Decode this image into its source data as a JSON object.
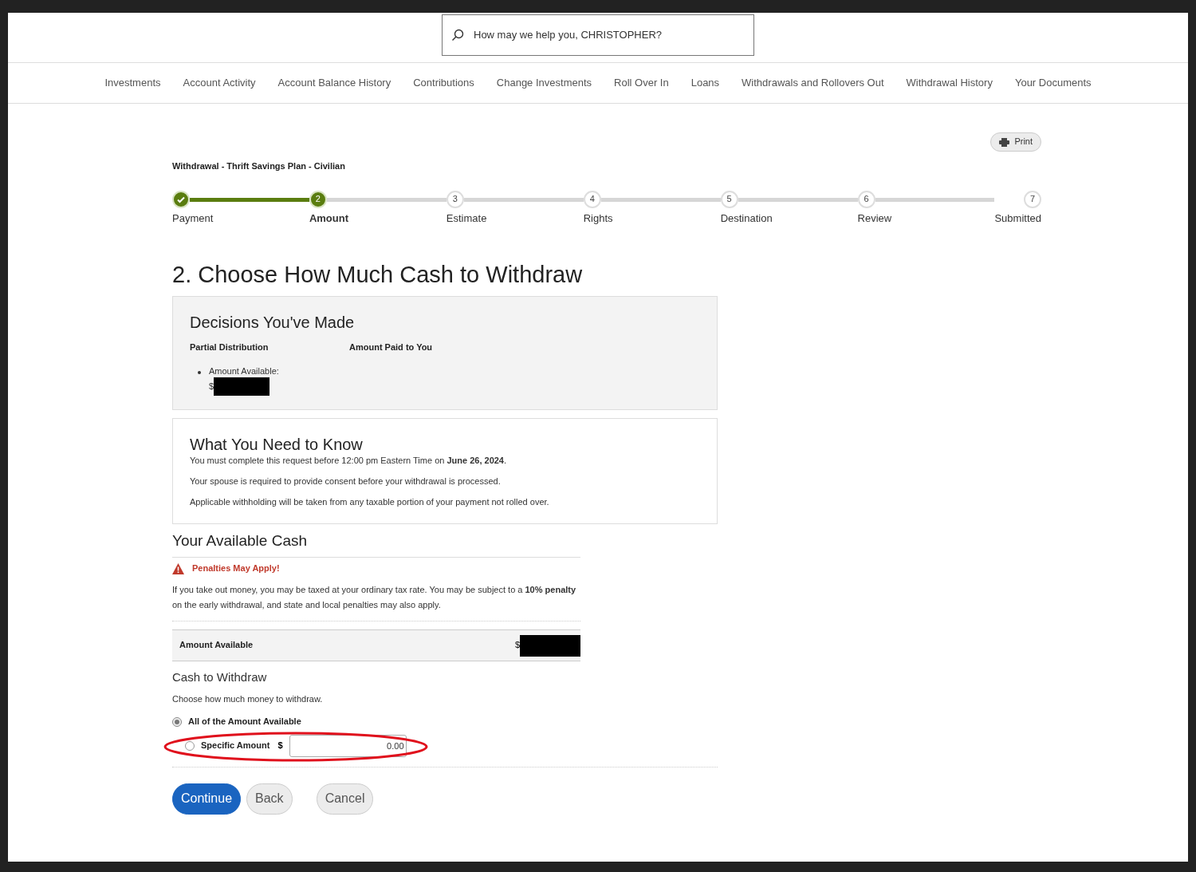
{
  "search": {
    "placeholder": "How may we help you, CHRISTOPHER?"
  },
  "nav": [
    {
      "label": "Investments"
    },
    {
      "label": "Account Activity"
    },
    {
      "label": "Account Balance History"
    },
    {
      "label": "Contributions"
    },
    {
      "label": "Change Investments"
    },
    {
      "label": "Roll Over In"
    },
    {
      "label": "Loans"
    },
    {
      "label": "Withdrawals and Rollovers Out"
    },
    {
      "label": "Withdrawal History"
    },
    {
      "label": "Your Documents"
    }
  ],
  "print_button": "Print",
  "plan_title": "Withdrawal - Thrift Savings Plan - Civilian",
  "steps": [
    {
      "label": "Payment",
      "complete": true,
      "selected": false
    },
    {
      "number": "2",
      "label": "Amount",
      "complete": false,
      "selected": true
    },
    {
      "number": "3",
      "label": "Estimate",
      "complete": false,
      "selected": false
    },
    {
      "number": "4",
      "label": "Rights",
      "complete": false,
      "selected": false
    },
    {
      "number": "5",
      "label": "Destination",
      "complete": false,
      "selected": false
    },
    {
      "number": "6",
      "label": "Review",
      "complete": false,
      "selected": false
    },
    {
      "number": "7",
      "label": "Submitted",
      "complete": false,
      "selected": false
    }
  ],
  "page_title": "2. Choose How Much Cash to Withdraw",
  "decisions": {
    "title": "Decisions You've Made",
    "column_1": "Partial Distribution",
    "column_2": "Amount Paid to You",
    "bullet": "Amount Available:",
    "currency": "$"
  },
  "know": {
    "title": "What You Need to Know",
    "lines": [
      "You must complete this request before 12:00 pm Eastern Time on **June 26, 2024**.",
      "Your spouse is required to provide consent before your withdrawal is processed.",
      "Applicable withholding will be taken from any taxable portion of your payment not rolled over."
    ]
  },
  "cash": {
    "title": "Your Available Cash",
    "warning": "Penalties May Apply!",
    "warning_text": "If you take out money, you may be taxed at your ordinary tax rate. You may be subject to a **10% penalty** on the early withdrawal, and state and local penalties may also apply.",
    "amount_label": "Amount Available",
    "currency": "$"
  },
  "withdraw": {
    "title": "Cash to Withdraw",
    "hint": "Choose how much money to withdraw.",
    "options": [
      {
        "label": "All of the Amount Available",
        "selected": true,
        "kind": "plain"
      },
      {
        "label": "Specific Amount",
        "selected": false,
        "kind": "amount",
        "currency": "$",
        "value": "0.00"
      }
    ]
  },
  "buttons": [
    {
      "label": "Continue",
      "kind": "primary"
    },
    {
      "label": "Back",
      "kind": "secondary"
    },
    {
      "label": "Cancel",
      "kind": "secondary"
    }
  ]
}
